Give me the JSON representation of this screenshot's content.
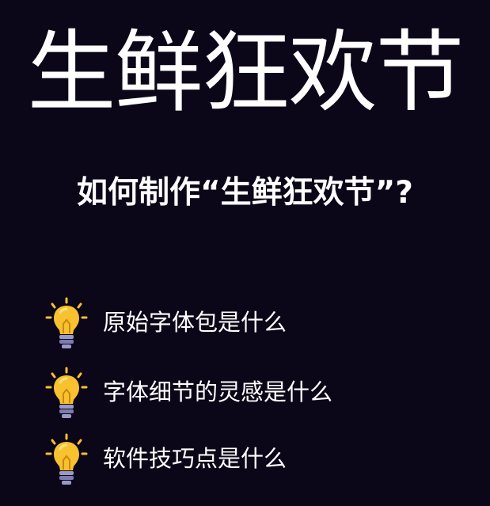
{
  "hero": {
    "title": "生鲜狂欢节"
  },
  "question": {
    "text": "如何制作“生鲜狂欢节”?"
  },
  "items": [
    {
      "icon": "lightbulb-icon",
      "label": "原始字体包是什么"
    },
    {
      "icon": "lightbulb-icon",
      "label": "字体细节的灵感是什么"
    },
    {
      "icon": "lightbulb-icon",
      "label": "软件技巧点是什么"
    }
  ],
  "colors": {
    "background": "#0b0618",
    "text": "#ffffff",
    "bulb_glass": "#f7c12f",
    "bulb_highlight": "#fde27a",
    "bulb_base": "#9a99c4",
    "bulb_rays": "#f7c12f"
  }
}
